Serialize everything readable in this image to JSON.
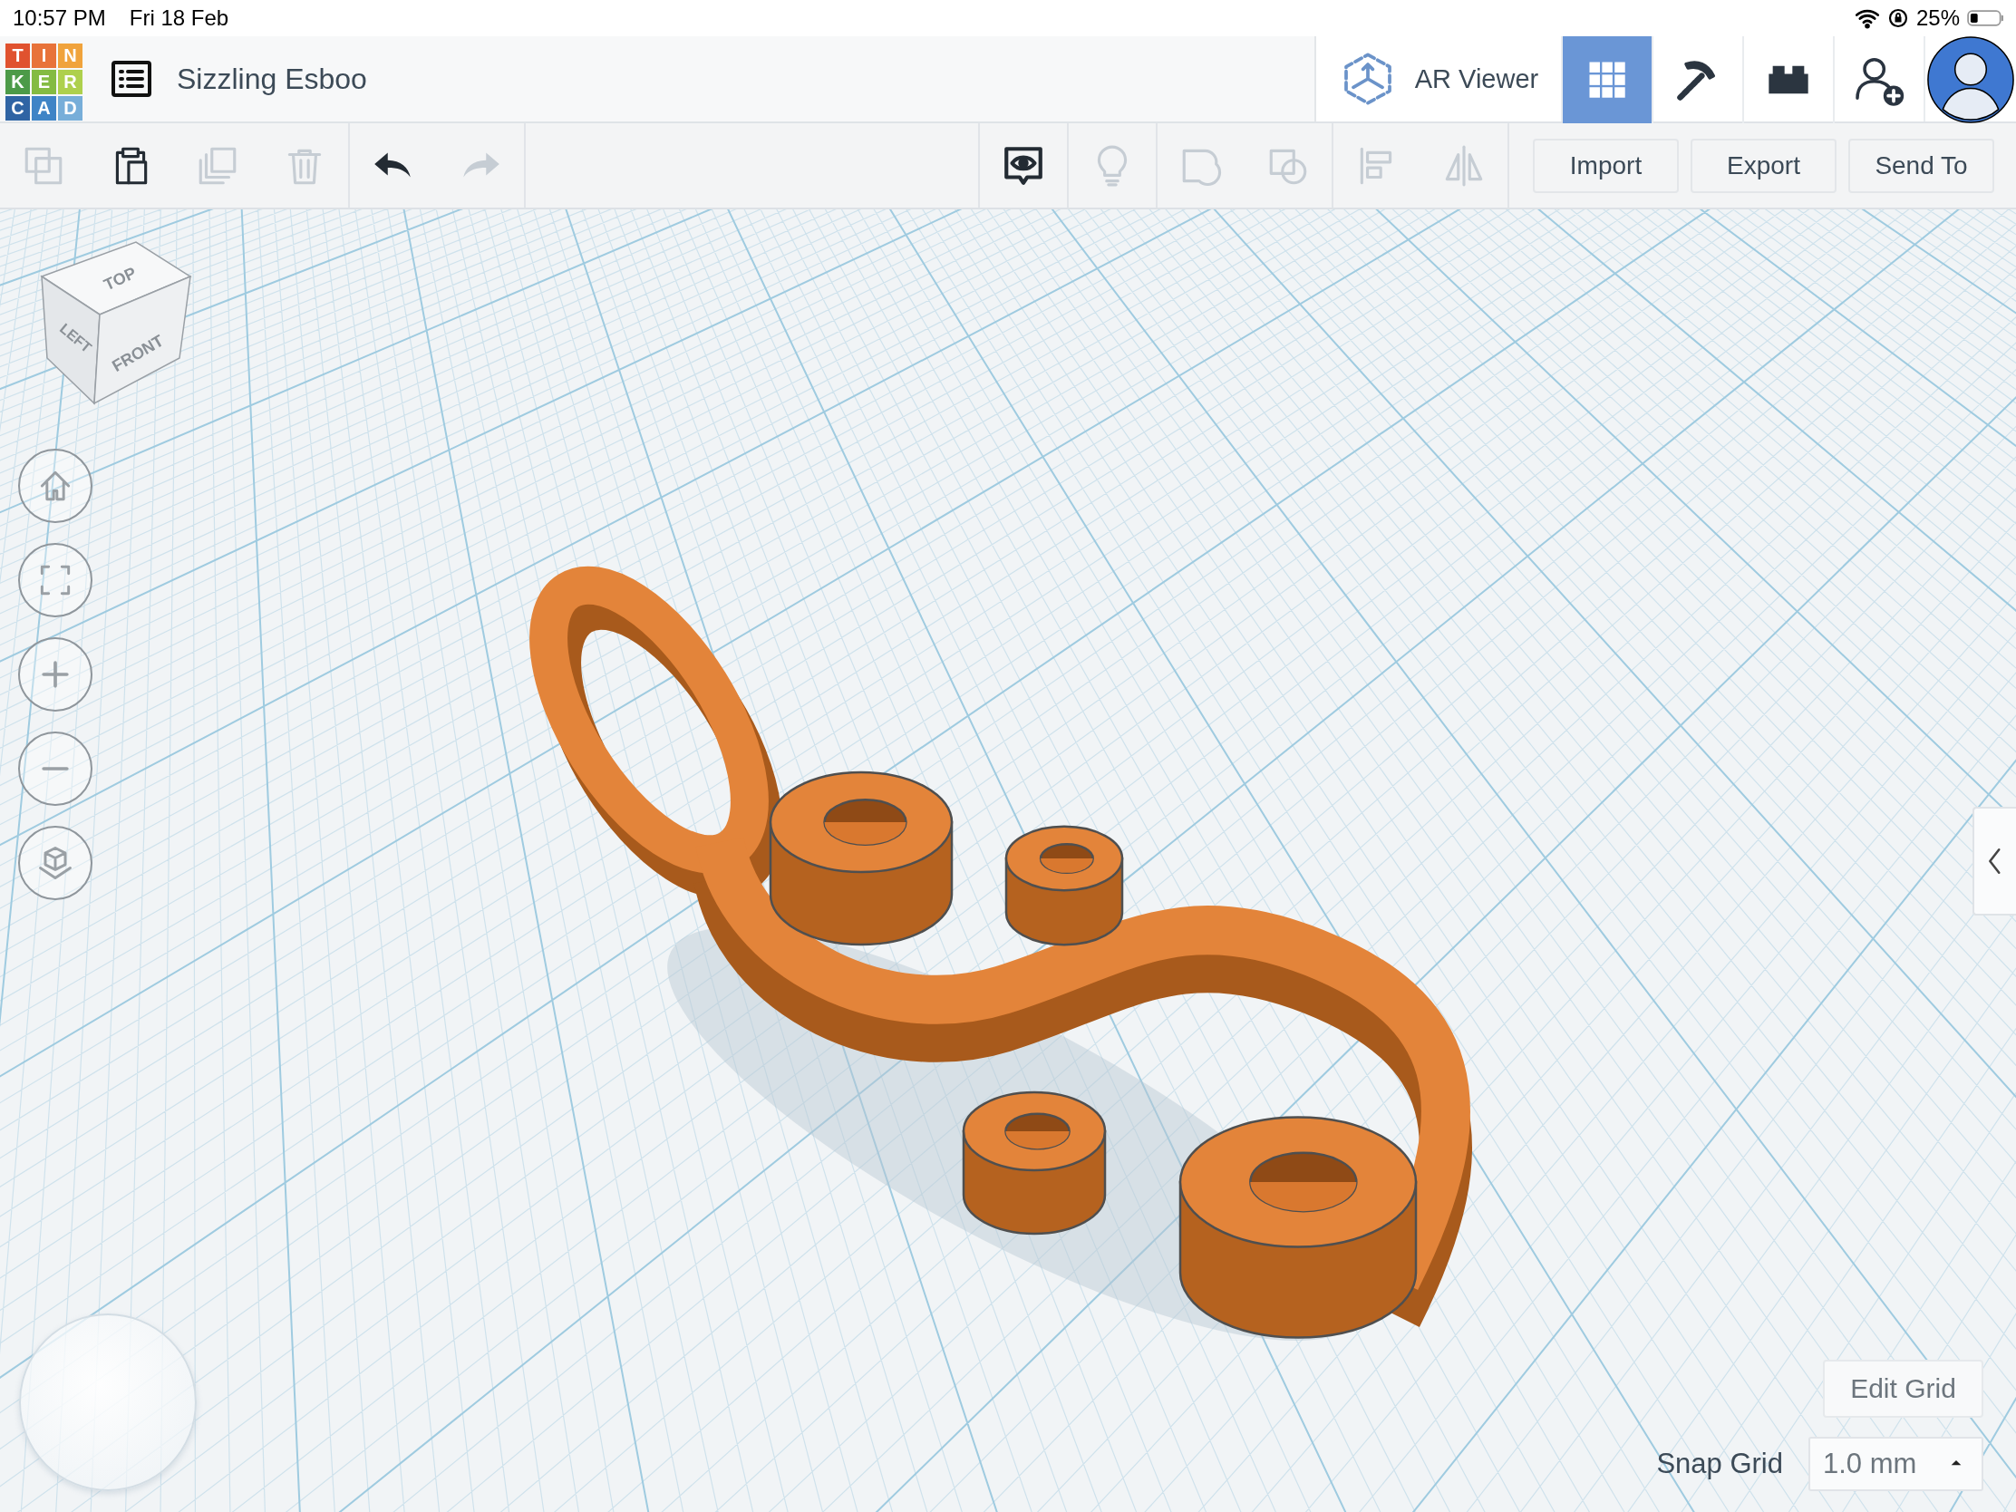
{
  "status_bar": {
    "time": "10:57 PM",
    "date": "Fri 18 Feb",
    "battery": "25%"
  },
  "header": {
    "logo_letters": [
      "T",
      "I",
      "N",
      "K",
      "E",
      "R",
      "C",
      "A",
      "D"
    ],
    "project_title": "Sizzling Esboo",
    "ar_viewer": "AR Viewer",
    "modes": [
      {
        "kind": "grid",
        "selected": true
      },
      {
        "kind": "pickaxe",
        "selected": false
      },
      {
        "kind": "bricks",
        "selected": false
      }
    ]
  },
  "toolbar": {
    "edit_tools": [
      {
        "kind": "copy",
        "disabled": true
      },
      {
        "kind": "paste",
        "disabled": false
      },
      {
        "kind": "duplicate",
        "disabled": true
      },
      {
        "kind": "delete",
        "disabled": true
      }
    ],
    "history": [
      {
        "kind": "undo",
        "disabled": false
      },
      {
        "kind": "redo",
        "disabled": true
      }
    ],
    "view_tool_groups": [
      [
        {
          "kind": "notes",
          "disabled": false
        }
      ],
      [
        {
          "kind": "lightbulb",
          "disabled": true
        }
      ],
      [
        {
          "kind": "group",
          "disabled": true
        },
        {
          "kind": "ungroup",
          "disabled": true
        }
      ],
      [
        {
          "kind": "align",
          "disabled": true
        },
        {
          "kind": "mirror",
          "disabled": true
        }
      ]
    ],
    "buttons": [
      "Import",
      "Export",
      "Send To"
    ]
  },
  "workplane": {
    "view_cube": [
      "TOP",
      "LEFT",
      "FRONT"
    ],
    "view_controls": [
      {
        "kind": "home"
      },
      {
        "kind": "fit"
      },
      {
        "kind": "zoom_in"
      },
      {
        "kind": "zoom_out"
      },
      {
        "kind": "perspective"
      }
    ],
    "edit_grid": "Edit Grid",
    "snap_grid_label": "Snap Grid",
    "snap_grid_value": "1.0 mm"
  }
}
